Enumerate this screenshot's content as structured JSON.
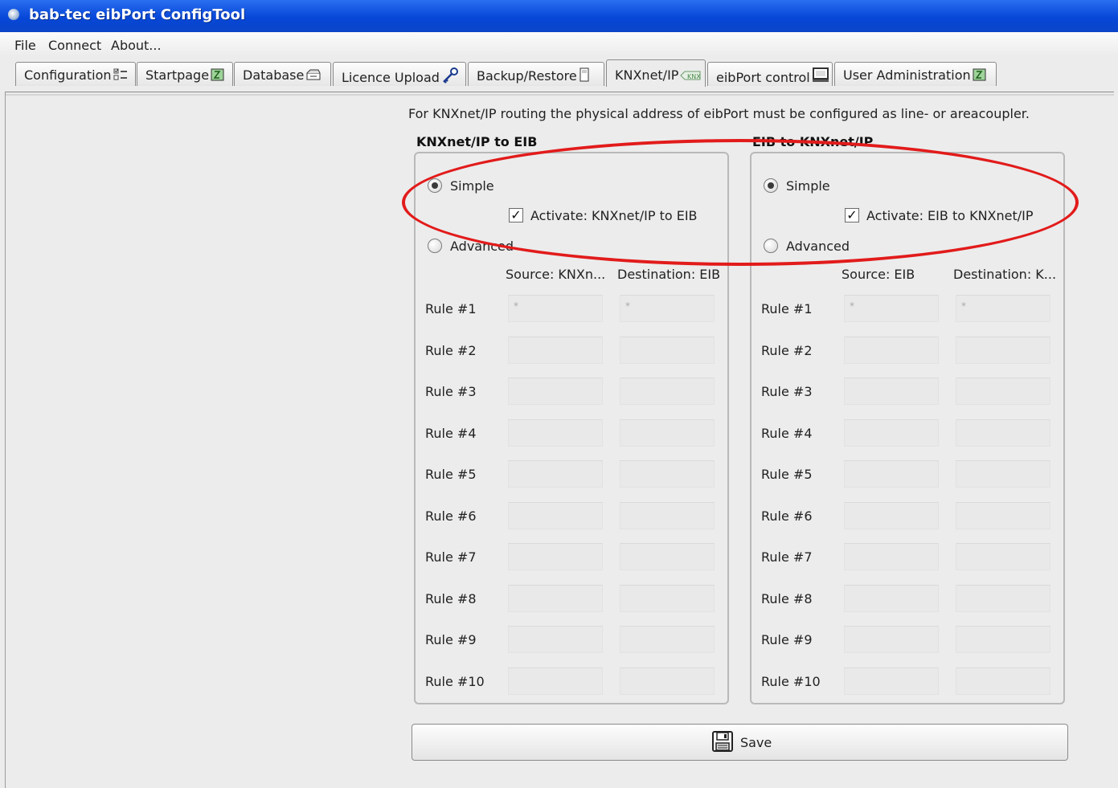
{
  "window": {
    "title": "bab-tec eibPort ConfigTool"
  },
  "menu": [
    "File",
    "Connect",
    "About..."
  ],
  "tabs": [
    {
      "label": "Configuration",
      "icon": "config-list-icon"
    },
    {
      "label": "Startpage",
      "icon": "startpage-icon"
    },
    {
      "label": "Database",
      "icon": "database-icon"
    },
    {
      "label": "Licence Upload",
      "icon": "key-icon"
    },
    {
      "label": "Backup/Restore",
      "icon": "backup-icon"
    },
    {
      "label": "KNXnet/IP",
      "icon": "knx-icon",
      "selected": true
    },
    {
      "label": "eibPort control",
      "icon": "monitor-icon"
    },
    {
      "label": "User Administration",
      "icon": "user-admin-icon"
    }
  ],
  "info_text": "For KNXnet/IP routing the physical address of eibPort must be configured as line- or areacoupler.",
  "groups": [
    {
      "title": "KNXnet/IP to EIB",
      "simple_label": "Simple",
      "simple_selected": true,
      "activate_label": "Activate: KNXnet/IP to EIB",
      "activate_checked": true,
      "advanced_label": "Advanced",
      "col_source": "Source: KNXn...",
      "col_dest": "Destination: EIB",
      "rules": [
        {
          "label": "Rule #1",
          "source": "*",
          "dest": "*"
        },
        {
          "label": "Rule #2",
          "source": "",
          "dest": ""
        },
        {
          "label": "Rule #3",
          "source": "",
          "dest": ""
        },
        {
          "label": "Rule #4",
          "source": "",
          "dest": ""
        },
        {
          "label": "Rule #5",
          "source": "",
          "dest": ""
        },
        {
          "label": "Rule #6",
          "source": "",
          "dest": ""
        },
        {
          "label": "Rule #7",
          "source": "",
          "dest": ""
        },
        {
          "label": "Rule #8",
          "source": "",
          "dest": ""
        },
        {
          "label": "Rule #9",
          "source": "",
          "dest": ""
        },
        {
          "label": "Rule #10",
          "source": "",
          "dest": ""
        }
      ]
    },
    {
      "title": "EIB to KNXnet/IP",
      "simple_label": "Simple",
      "simple_selected": true,
      "activate_label": "Activate: EIB to KNXnet/IP",
      "activate_checked": true,
      "advanced_label": "Advanced",
      "col_source": "Source: EIB",
      "col_dest": "Destination: K...",
      "rules": [
        {
          "label": "Rule #1",
          "source": "*",
          "dest": "*"
        },
        {
          "label": "Rule #2",
          "source": "",
          "dest": ""
        },
        {
          "label": "Rule #3",
          "source": "",
          "dest": ""
        },
        {
          "label": "Rule #4",
          "source": "",
          "dest": ""
        },
        {
          "label": "Rule #5",
          "source": "",
          "dest": ""
        },
        {
          "label": "Rule #6",
          "source": "",
          "dest": ""
        },
        {
          "label": "Rule #7",
          "source": "",
          "dest": ""
        },
        {
          "label": "Rule #8",
          "source": "",
          "dest": ""
        },
        {
          "label": "Rule #9",
          "source": "",
          "dest": ""
        },
        {
          "label": "Rule #10",
          "source": "",
          "dest": ""
        }
      ]
    }
  ],
  "save_label": "Save",
  "colors": {
    "title_bar": "#0747d8",
    "annotation": "#e21b1b",
    "background": "#ececec"
  }
}
